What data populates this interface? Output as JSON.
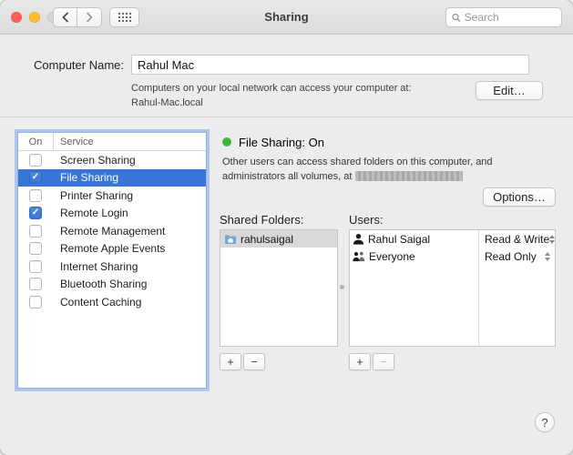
{
  "window": {
    "title": "Sharing",
    "search_placeholder": "Search"
  },
  "computer_name": {
    "label": "Computer Name:",
    "value": "Rahul Mac",
    "description_line1": "Computers on your local network can access your computer at:",
    "description_line2": "Rahul-Mac.local",
    "edit_button": "Edit…"
  },
  "services": {
    "columns": {
      "on": "On",
      "service": "Service"
    },
    "items": [
      {
        "label": "Screen Sharing",
        "checked": false,
        "selected": false
      },
      {
        "label": "File Sharing",
        "checked": true,
        "selected": true
      },
      {
        "label": "Printer Sharing",
        "checked": false,
        "selected": false
      },
      {
        "label": "Remote Login",
        "checked": true,
        "selected": false
      },
      {
        "label": "Remote Management",
        "checked": false,
        "selected": false
      },
      {
        "label": "Remote Apple Events",
        "checked": false,
        "selected": false
      },
      {
        "label": "Internet Sharing",
        "checked": false,
        "selected": false
      },
      {
        "label": "Bluetooth Sharing",
        "checked": false,
        "selected": false
      },
      {
        "label": "Content Caching",
        "checked": false,
        "selected": false
      }
    ]
  },
  "detail": {
    "status_title": "File Sharing: On",
    "description": "Other users can access shared folders on this computer, and administrators all volumes, at",
    "options_button": "Options…",
    "shared_folders": {
      "label": "Shared Folders:",
      "items": [
        {
          "name": "rahulsaigal"
        }
      ]
    },
    "users": {
      "label": "Users:",
      "items": [
        {
          "name": "Rahul Saigal",
          "permission": "Read & Write"
        },
        {
          "name": "Everyone",
          "permission": "Read Only"
        }
      ]
    }
  },
  "list_controls": {
    "add": "+",
    "remove": "−"
  },
  "help_button": "?",
  "colors": {
    "accent_blue": "#3875d7",
    "status_green": "#3db53d",
    "focus_ring": "#7aa7e8",
    "traffic_red": "#ff5f57",
    "traffic_yellow": "#febc2e",
    "traffic_gray": "#d8d6d4"
  }
}
